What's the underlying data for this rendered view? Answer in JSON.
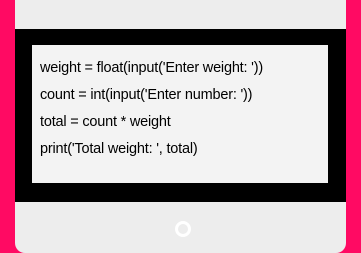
{
  "colors": {
    "background": "#ff0a63",
    "device_frame": "#ededed",
    "screen": "#000000",
    "code_background": "#f3f3f3",
    "code_text": "#000000",
    "home_button": "#ffffff"
  },
  "screen": {
    "code_lines": [
      "weight = float(input('Enter weight: '))",
      "count = int(input('Enter number: '))",
      "total = count * weight",
      "print('Total weight: ', total)"
    ]
  },
  "device": {
    "home_button_icon": "circle-home-icon"
  }
}
